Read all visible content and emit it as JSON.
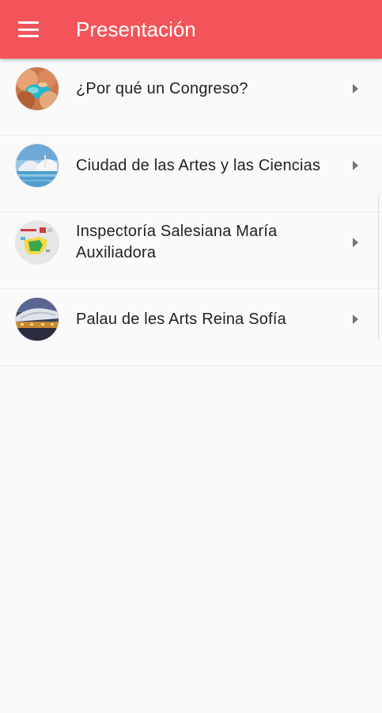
{
  "app_bar": {
    "title": "Presentación",
    "menu_icon": "menu-icon",
    "background": "#f25459"
  },
  "items": [
    {
      "label": "¿Por qué un Congreso?",
      "thumb": "hands-photo",
      "chevron": "chevron-right-icon"
    },
    {
      "label": "Ciudad de las Artes y las Ciencias",
      "thumb": "city-arts-sciences-photo",
      "chevron": "chevron-right-icon"
    },
    {
      "label": "Inspectoría Salesiana María Auxiliadora",
      "thumb": "spain-map-logo",
      "chevron": "chevron-right-icon"
    },
    {
      "label": "Palau de les Arts Reina Sofía",
      "thumb": "palau-arts-photo",
      "chevron": "chevron-right-icon"
    }
  ]
}
